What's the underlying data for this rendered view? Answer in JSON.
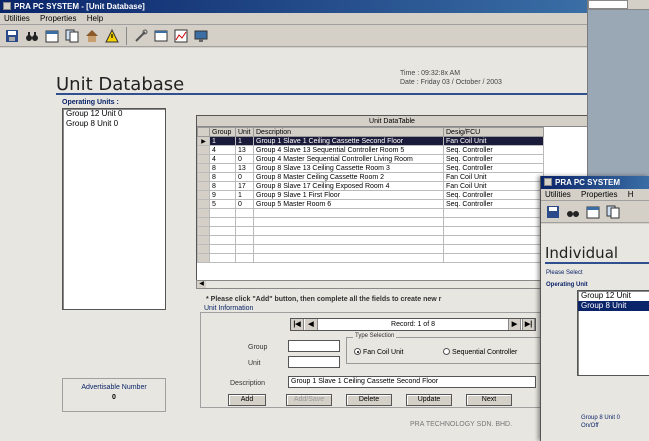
{
  "main_window": {
    "title": "PRA PC SYSTEM - [Unit Database]",
    "menu": [
      "Utilities",
      "Properties",
      "Help"
    ],
    "toolbar_icons": [
      "save-icon",
      "binoculars-icon",
      "calendar-icon",
      "documents-icon",
      "building-icon",
      "warning-icon",
      "tools-icon",
      "window-icon",
      "graph-icon",
      "monitor-icon"
    ]
  },
  "header": {
    "title": "Unit Database",
    "time": "Time : 09:32:8x AM",
    "date": "Date : Friday 03 / October / 2003"
  },
  "operating_units": {
    "label": "Operating Units :",
    "items": [
      "Group 12  Unit  0",
      "Group 8  Unit  0"
    ]
  },
  "unit_table": {
    "caption": "Unit DataTable",
    "columns": [
      "Group",
      "Unit",
      "Description",
      "Desig/FCU"
    ],
    "rows": [
      {
        "group": "1",
        "unit": "1",
        "description": "Group 1 Slave 1 Ceiling Cassette  Second Floor",
        "desig": "Fan Coil Unit",
        "selected": true
      },
      {
        "group": "4",
        "unit": "13",
        "description": "Group 4 Slave 13 Sequential Controller  Room 5",
        "desig": "Seq. Controller",
        "selected": false
      },
      {
        "group": "4",
        "unit": "0",
        "description": "Group 4 Master  Sequential Controller  Living Room",
        "desig": "Seq. Controller",
        "selected": false
      },
      {
        "group": "8",
        "unit": "13",
        "description": "Group 8 Slave 13 Ceiling Cassette  Room 3",
        "desig": "Seq. Controller",
        "selected": false
      },
      {
        "group": "8",
        "unit": "0",
        "description": "Group 8 Master  Ceiling Cassette  Room 2",
        "desig": "Fan Coil Unit",
        "selected": false
      },
      {
        "group": "8",
        "unit": "17",
        "description": "Group 8 Slave 17 Ceiling Exposed  Room 4",
        "desig": "Fan Coil Unit",
        "selected": false
      },
      {
        "group": "9",
        "unit": "1",
        "description": "Group 9 Slave 1  First Floor",
        "desig": "Seq. Controller",
        "selected": false
      },
      {
        "group": "5",
        "unit": "0",
        "description": "Group 5 Master  Room 6",
        "desig": "Seq. Controller",
        "selected": false
      }
    ]
  },
  "notice": "* Please click \"Add\" button, then complete all the fields to create new r",
  "unit_information": {
    "label": "Unit Information",
    "record": "Record: 1 of 8",
    "group_label": "Group",
    "unit_label": "Unit",
    "type_label": "Type Selection",
    "radio_fan": "Fan Coil Unit",
    "radio_seq": "Sequential Controller",
    "description_label": "Description",
    "description_value": "Group 1 Slave 1  Ceiling Cassette  Second Floor",
    "buttons": [
      "Add",
      "Add/Save",
      "Delete",
      "Update",
      "Next"
    ]
  },
  "advertisable": {
    "label": "Advertisable Number",
    "value": "0"
  },
  "footer": "PRA TECHNOLOGY SDN. BHD.",
  "secondary_window": {
    "title": "PRA PC SYSTEM",
    "menu": [
      "Utilities",
      "Properties",
      "H"
    ],
    "heading": "Individual",
    "subtext": "Please Select",
    "operating_label": "Operating Unit",
    "list_items": [
      "Group 12  Unit",
      "Group 8  Unit"
    ],
    "footer_line1": "Group 8 Unit 0",
    "footer_line2": "On/Off"
  }
}
